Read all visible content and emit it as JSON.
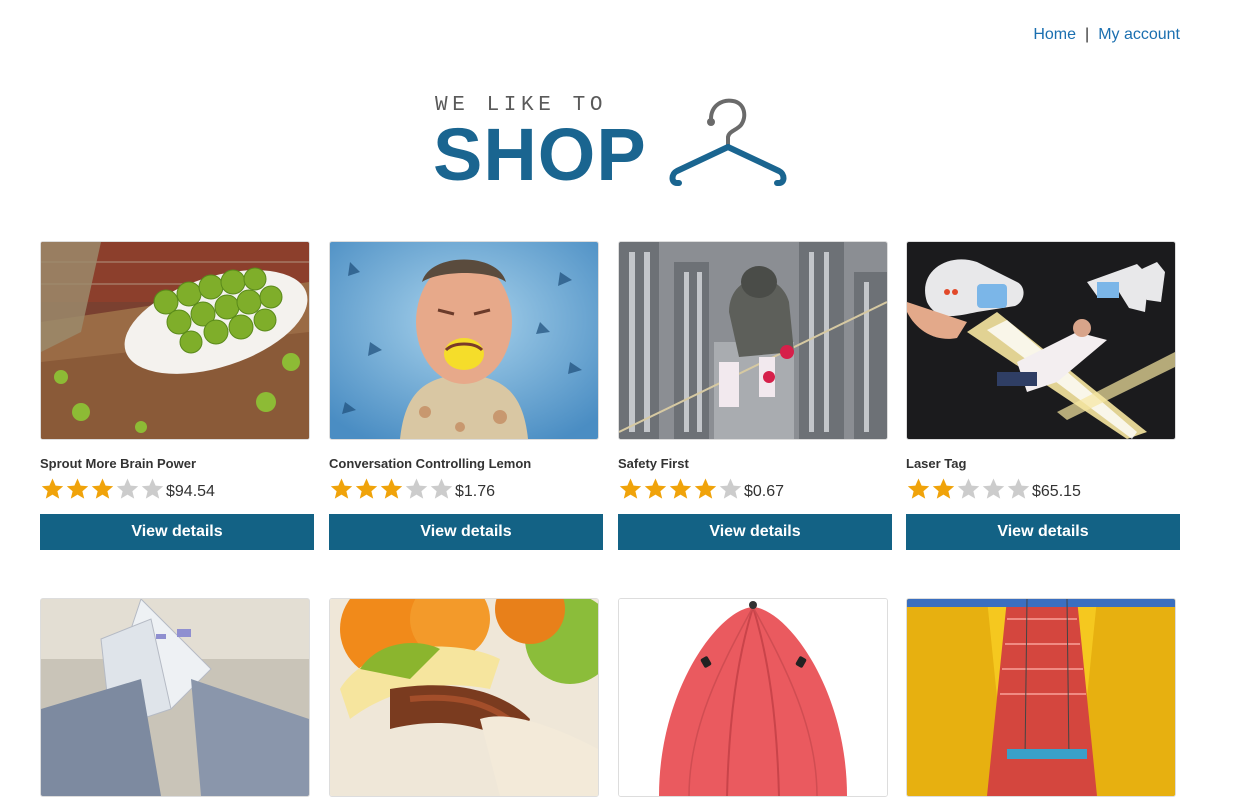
{
  "nav": {
    "home": "Home",
    "separator": "|",
    "account": "My account"
  },
  "logo": {
    "tagline": "WE LIKE TO",
    "word": "SHOP",
    "icon": "hanger-icon",
    "color": "#1a6590"
  },
  "colors": {
    "button": "#136285",
    "star_on": "#f0a30a",
    "star_off": "#cccccc",
    "link": "#1a6fb0"
  },
  "products": [
    {
      "title": "Sprout More Brain Power",
      "rating": 3,
      "price": "$94.54",
      "button": "View details",
      "image": "brussels-sprouts-photo"
    },
    {
      "title": "Conversation Controlling Lemon",
      "rating": 3,
      "price": "$1.76",
      "button": "View details",
      "image": "man-biting-lemon-photo"
    },
    {
      "title": "Safety First",
      "rating": 4,
      "price": "$0.67",
      "button": "View details",
      "image": "tightrope-walker-city-photo"
    },
    {
      "title": "Laser Tag",
      "rating": 2,
      "price": "$65.15",
      "button": "View details",
      "image": "laser-tag-guns-photo"
    }
  ],
  "products_row2": [
    {
      "image": "origami-boat-photo"
    },
    {
      "image": "fruit-banana-photo"
    },
    {
      "image": "red-umbrella-photo"
    },
    {
      "image": "inflatable-slide-photo"
    }
  ]
}
